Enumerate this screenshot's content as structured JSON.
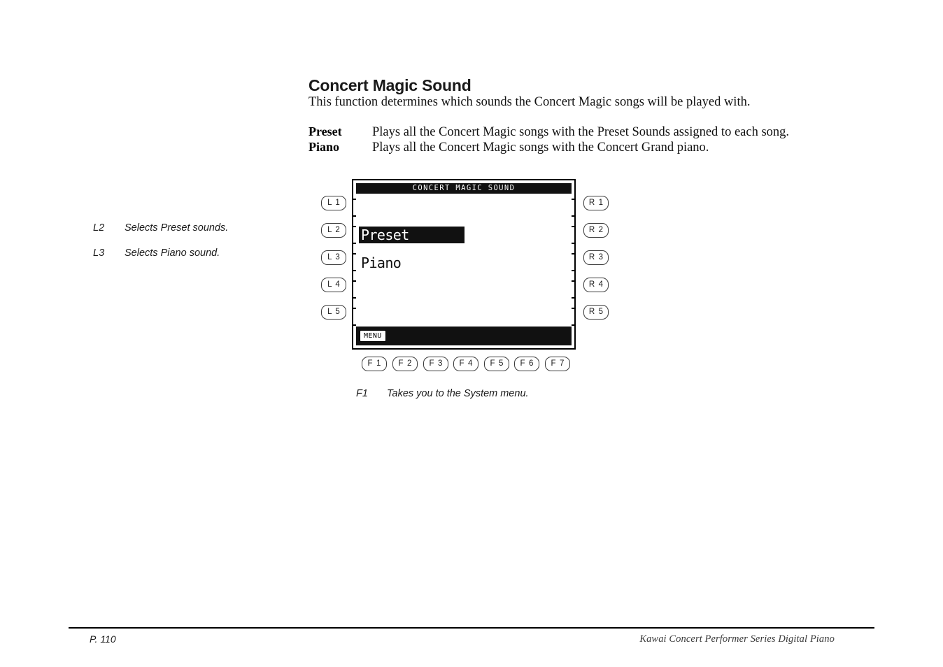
{
  "page": {
    "heading": "Concert Magic Sound",
    "intro": "This function determines which sounds the Concert Magic songs will be played with."
  },
  "definitions": [
    {
      "term": "Preset",
      "description": "Plays all the Concert Magic songs with the Preset Sounds assigned to each song."
    },
    {
      "term": "Piano",
      "description": "Plays all the Concert Magic songs with the Concert Grand piano."
    }
  ],
  "annotations": [
    {
      "key": "L2",
      "text": "Selects Preset sounds."
    },
    {
      "key": "L3",
      "text": "Selects Piano sound."
    }
  ],
  "function_caption": {
    "key": "F1",
    "text": "Takes you to the System menu."
  },
  "lcd": {
    "title": "CONCERT MAGIC SOUND",
    "items": [
      {
        "label": "Preset",
        "selected": true
      },
      {
        "label": "Piano",
        "selected": false
      }
    ],
    "softkeys": [
      {
        "label": "MENU"
      }
    ],
    "colors": {
      "background": "#ffffff",
      "foreground": "#111111",
      "highlight_text": "#ffffff"
    }
  },
  "buttons": {
    "left": [
      "L 1",
      "L 2",
      "L 3",
      "L 4",
      "L 5"
    ],
    "right": [
      "R 1",
      "R 2",
      "R 3",
      "R 4",
      "R 5"
    ],
    "function": [
      "F 1",
      "F 2",
      "F 3",
      "F 4",
      "F 5",
      "F 6",
      "F 7"
    ]
  },
  "footer": {
    "page_number": "P. 110",
    "product": "Kawai Concert Performer Series Digital Piano"
  }
}
